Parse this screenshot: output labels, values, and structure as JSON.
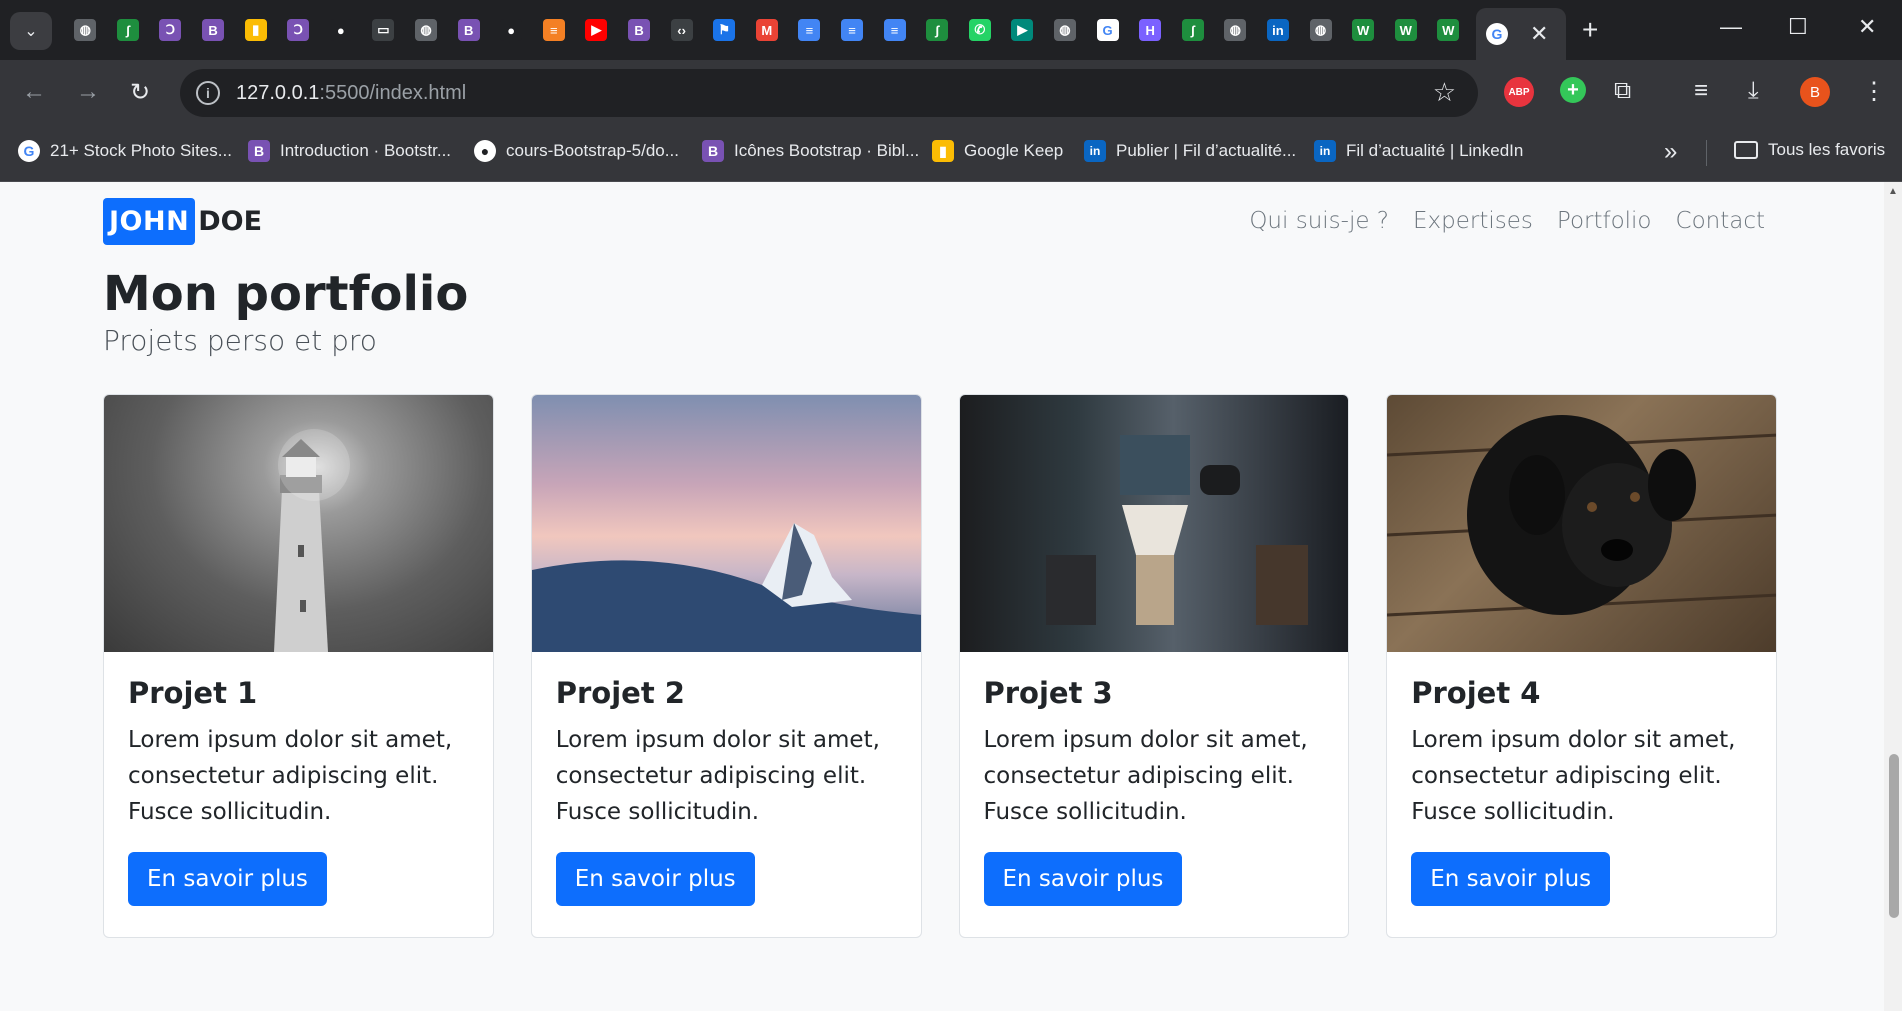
{
  "browser": {
    "url_host": "127.0.0.1",
    "url_rest": ":5500/index.html",
    "active_tab_close": "✕",
    "new_tab": "+",
    "bookmarks": [
      {
        "label": "21+ Stock Photo Sites...",
        "icon": "google-icon",
        "color": "#ffffff",
        "glyph": "G"
      },
      {
        "label": "Introduction · Bootstr...",
        "icon": "bootstrap-icon",
        "color": "#7952b3",
        "glyph": "B"
      },
      {
        "label": "cours-Bootstrap-5/do...",
        "icon": "github-icon",
        "color": "#ffffff",
        "glyph": "●"
      },
      {
        "label": "Icônes Bootstrap · Bibl...",
        "icon": "bootstrap-icon",
        "color": "#7952b3",
        "glyph": "B"
      },
      {
        "label": "Google Keep",
        "icon": "keep-icon",
        "color": "#fbbc04",
        "glyph": "▮"
      },
      {
        "label": "Publier | Fil d’actualité...",
        "icon": "linkedin-icon",
        "color": "#0a66c2",
        "glyph": "in"
      },
      {
        "label": "Fil d’actualité | LinkedIn",
        "icon": "linkedin-icon",
        "color": "#0a66c2",
        "glyph": "in"
      }
    ],
    "all_bookmarks": "Tous les favoris",
    "avatar_letter": "B",
    "abp_label": "ABP"
  },
  "site": {
    "brand_first": "JOHN",
    "brand_last": "DOE",
    "nav": [
      "Qui suis-je ?",
      "Expertises",
      "Portfolio",
      "Contact"
    ],
    "title": "Mon portfolio",
    "subtitle": "Projets perso et pro",
    "projects": [
      {
        "title": "Projet 1",
        "text": "Lorem ipsum dolor sit amet, consectetur adipiscing elit. Fusce sollicitudin.",
        "button": "En savoir plus"
      },
      {
        "title": "Projet 2",
        "text": "Lorem ipsum dolor sit amet, consectetur adipiscing elit. Fusce sollicitudin.",
        "button": "En savoir plus"
      },
      {
        "title": "Projet 3",
        "text": "Lorem ipsum dolor sit amet, consectetur adipiscing elit. Fusce sollicitudin.",
        "button": "En savoir plus"
      },
      {
        "title": "Projet 4",
        "text": "Lorem ipsum dolor sit amet, consectetur adipiscing elit. Fusce sollicitudin.",
        "button": "En savoir plus"
      }
    ]
  },
  "colors": {
    "primary": "#0d6efd",
    "page_bg": "#f8f9fa",
    "chrome_dark": "#202124",
    "chrome_toolbar": "#35363a"
  }
}
